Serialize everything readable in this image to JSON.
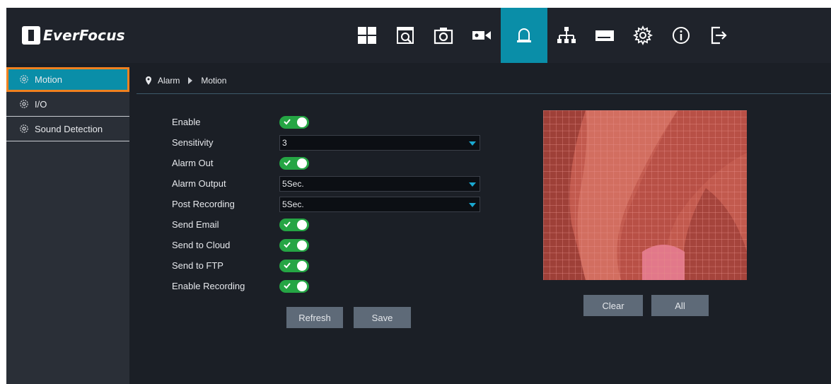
{
  "brand": {
    "name": "EverFocus"
  },
  "nav": {
    "items": [
      {
        "name": "live-view-icon",
        "active": false
      },
      {
        "name": "playback-icon",
        "active": false
      },
      {
        "name": "snapshot-icon",
        "active": false
      },
      {
        "name": "camera-icon",
        "active": false
      },
      {
        "name": "alarm-icon",
        "active": true
      },
      {
        "name": "network-icon",
        "active": false
      },
      {
        "name": "storage-icon",
        "active": false
      },
      {
        "name": "settings-icon",
        "active": false
      },
      {
        "name": "info-icon",
        "active": false
      },
      {
        "name": "logout-icon",
        "active": false
      }
    ]
  },
  "sidebar": {
    "items": [
      {
        "label": "Motion",
        "active": true
      },
      {
        "label": "I/O",
        "active": false
      },
      {
        "label": "Sound Detection",
        "active": false
      }
    ]
  },
  "breadcrumb": {
    "root": "Alarm",
    "current": "Motion"
  },
  "form": {
    "enable": {
      "label": "Enable",
      "on": true
    },
    "sensitivity": {
      "label": "Sensitivity",
      "value": "3"
    },
    "alarm_out": {
      "label": "Alarm Out",
      "on": true
    },
    "alarm_output": {
      "label": "Alarm Output",
      "value": "5Sec."
    },
    "post_recording": {
      "label": "Post Recording",
      "value": "5Sec."
    },
    "send_email": {
      "label": "Send Email",
      "on": true
    },
    "send_cloud": {
      "label": "Send to Cloud",
      "on": true
    },
    "send_ftp": {
      "label": "Send to FTP",
      "on": true
    },
    "enable_recording": {
      "label": "Enable Recording",
      "on": true
    }
  },
  "buttons": {
    "refresh": "Refresh",
    "save": "Save",
    "clear": "Clear",
    "all": "All"
  },
  "colors": {
    "accent": "#0a8ea8",
    "highlight": "#f0811f",
    "toggle_on": "#25a544"
  }
}
